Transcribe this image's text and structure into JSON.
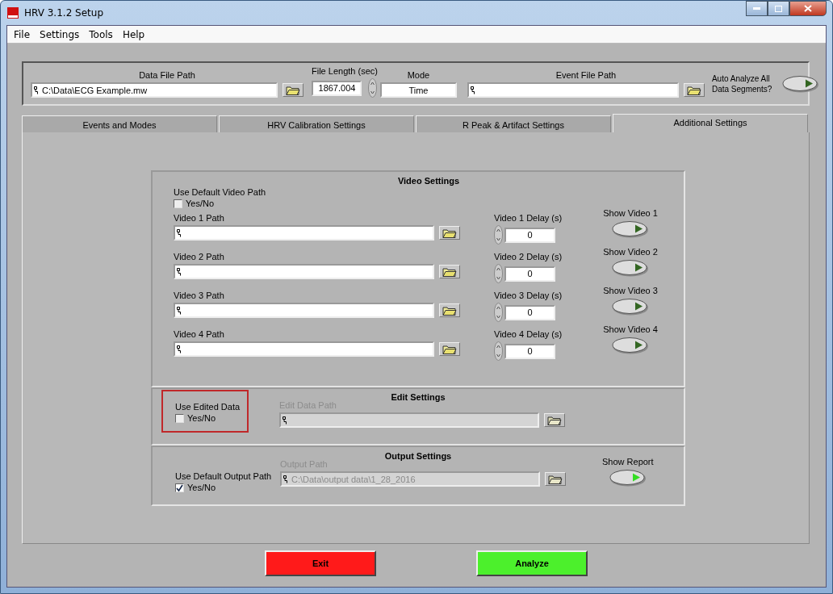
{
  "window": {
    "title": "HRV 3.1.2 Setup"
  },
  "menu": [
    "File",
    "Settings",
    "Tools",
    "Help"
  ],
  "file_panel": {
    "data_file_path": {
      "label": "Data File Path",
      "value": "C:\\Data\\ECG Example.mw"
    },
    "file_length": {
      "label": "File Length (sec)",
      "value": "1867.004"
    },
    "mode": {
      "label": "Mode",
      "value": "Time"
    },
    "event_file_path": {
      "label": "Event File Path"
    },
    "auto_analyze": {
      "label": "Auto Analyze All Data Segments?",
      "on": false
    }
  },
  "tabs": [
    {
      "label": "Events and Modes",
      "selected": false
    },
    {
      "label": "HRV Calibration Settings",
      "selected": false
    },
    {
      "label": "R Peak & Artifact Settings",
      "selected": false
    },
    {
      "label": "Additional Settings",
      "selected": true
    }
  ],
  "video_settings": {
    "title": "Video Settings",
    "default_path": {
      "label": "Use Default Video Path",
      "option": "Yes/No",
      "checked": false
    },
    "videos": [
      {
        "path_label": "Video 1 Path",
        "delay_label": "Video 1 Delay (s)",
        "delay": "0",
        "show_label": "Show Video 1",
        "on": false
      },
      {
        "path_label": "Video 2 Path",
        "delay_label": "Video 2 Delay (s)",
        "delay": "0",
        "show_label": "Show Video 2",
        "on": false
      },
      {
        "path_label": "Video 3 Path",
        "delay_label": "Video 3 Delay (s)",
        "delay": "0",
        "show_label": "Show Video 3",
        "on": false
      },
      {
        "path_label": "Video 4 Path",
        "delay_label": "Video 4 Delay (s)",
        "delay": "0",
        "show_label": "Show Video 4",
        "on": false
      }
    ]
  },
  "edit_settings": {
    "title": "Edit Settings",
    "use_edited": {
      "label": "Use Edited Data",
      "option": "Yes/No",
      "checked": false,
      "highlighted": true
    },
    "path": {
      "label": "Edit Data Path",
      "disabled": true
    }
  },
  "output_settings": {
    "title": "Output Settings",
    "default_path": {
      "label": "Use Default Output Path",
      "option": "Yes/No",
      "checked": true
    },
    "path": {
      "label": "Output Path",
      "value": "C:\\Data\\output data\\1_28_2016",
      "disabled": true
    },
    "report": {
      "label": "Show Report",
      "on": true
    }
  },
  "buttons": [
    {
      "label": "Exit",
      "kind": "exit"
    },
    {
      "label": "Analyze",
      "kind": "analyze"
    }
  ]
}
